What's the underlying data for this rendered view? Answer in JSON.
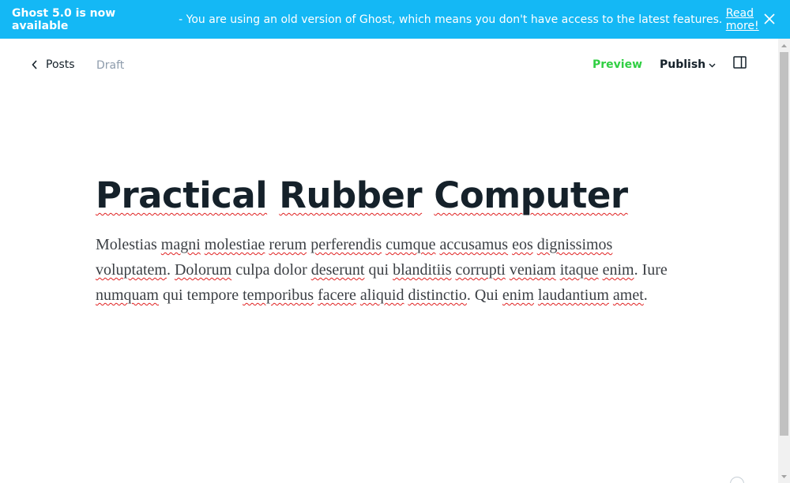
{
  "banner": {
    "strong": "Ghost 5.0 is now available",
    "message": " - You are using an old version of Ghost, which means you don't have access to the latest features. ",
    "link": "Read more!",
    "color": "#14b8f5"
  },
  "header": {
    "back_label": "Posts",
    "status": "Draft",
    "preview_label": "Preview",
    "publish_label": "Publish"
  },
  "post": {
    "title_words": [
      "Practical",
      "Rubber",
      "Computer"
    ],
    "body": [
      {
        "t": "Molestias",
        "s": false
      },
      {
        "t": " ",
        "s": false
      },
      {
        "t": "magni",
        "s": true
      },
      {
        "t": " ",
        "s": false
      },
      {
        "t": "molestiae",
        "s": true
      },
      {
        "t": " ",
        "s": false
      },
      {
        "t": "rerum",
        "s": true
      },
      {
        "t": " ",
        "s": false
      },
      {
        "t": "perferendis",
        "s": true
      },
      {
        "t": " ",
        "s": false
      },
      {
        "t": "cumque",
        "s": true
      },
      {
        "t": " ",
        "s": false
      },
      {
        "t": "accusamus",
        "s": true
      },
      {
        "t": " ",
        "s": false
      },
      {
        "t": "eos",
        "s": true
      },
      {
        "t": " ",
        "s": false
      },
      {
        "t": "dignissimos",
        "s": true
      },
      {
        "t": " ",
        "s": false
      },
      {
        "t": "voluptatem",
        "s": true
      },
      {
        "t": ". ",
        "s": false
      },
      {
        "t": "Dolorum",
        "s": true
      },
      {
        "t": " culpa dolor ",
        "s": false
      },
      {
        "t": "deserunt",
        "s": true
      },
      {
        "t": " qui ",
        "s": false
      },
      {
        "t": "blanditiis",
        "s": true
      },
      {
        "t": " ",
        "s": false
      },
      {
        "t": "corrupti",
        "s": true
      },
      {
        "t": " ",
        "s": false
      },
      {
        "t": "veniam",
        "s": true
      },
      {
        "t": " ",
        "s": false
      },
      {
        "t": "itaque",
        "s": true
      },
      {
        "t": " ",
        "s": false
      },
      {
        "t": "enim",
        "s": true
      },
      {
        "t": ". Iure ",
        "s": false
      },
      {
        "t": "numquam",
        "s": true
      },
      {
        "t": " qui tempore ",
        "s": false
      },
      {
        "t": "temporibus",
        "s": true
      },
      {
        "t": " ",
        "s": false
      },
      {
        "t": "facere",
        "s": true
      },
      {
        "t": " ",
        "s": false
      },
      {
        "t": "aliquid",
        "s": true
      },
      {
        "t": " ",
        "s": false
      },
      {
        "t": "distinctio",
        "s": true
      },
      {
        "t": ". Qui ",
        "s": false
      },
      {
        "t": "enim",
        "s": true
      },
      {
        "t": " ",
        "s": false
      },
      {
        "t": "laudantium",
        "s": true
      },
      {
        "t": " ",
        "s": false
      },
      {
        "t": "amet",
        "s": true
      },
      {
        "t": ".",
        "s": false
      }
    ]
  },
  "icons": {
    "close": "close-icon",
    "back": "chevron-left-icon",
    "publish_caret": "chevron-down-icon",
    "sidebar": "sidebar-toggle-icon"
  },
  "colors": {
    "preview": "#30cf43",
    "text": "#15212a",
    "muted": "#8e9cac",
    "spellcheck": "#e02020"
  }
}
